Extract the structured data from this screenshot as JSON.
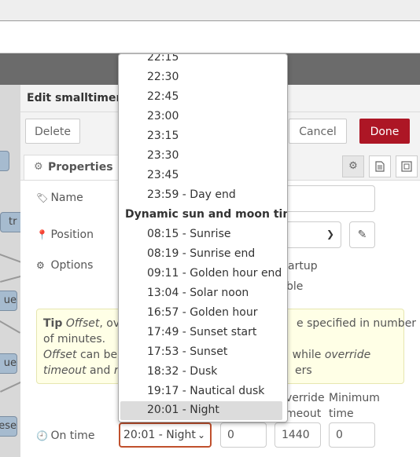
{
  "dialog": {
    "title": "Edit smalltimer node",
    "buttons": {
      "delete": "Delete",
      "cancel": "Cancel",
      "done": "Done"
    },
    "tab": "Properties"
  },
  "workspace": {
    "nodes": [
      "tr",
      "ue",
      "ue",
      "ese"
    ]
  },
  "form": {
    "name_label": "Name",
    "position_label": "Position",
    "options_label": "Options",
    "options_partial": [
      "artup",
      "ble"
    ],
    "on_time_label": "On time"
  },
  "tip": {
    "bold": "Tip",
    "line1_a": "Offset",
    "line1_b": ", over",
    "line1_c": "e specified in number",
    "line2": "of minutes.",
    "line3_a": "Offset",
    "line3_b": " can be b",
    "line3_c": "r, while ",
    "line3_d": "override",
    "line4_a": "timeout",
    "line4_b": " and ",
    "line4_c": "mi",
    "line4_d": "ers"
  },
  "columns": {
    "override_1": "verride",
    "override_2": "meout",
    "minimum_1": "Minimum",
    "minimum_2": "time"
  },
  "on_time": {
    "selected": "20:01 - Night",
    "offset": "0",
    "override_timeout": "1440",
    "minimum_time": "0"
  },
  "dropdown": {
    "times": [
      "22:15",
      "22:30",
      "22:45",
      "23:00",
      "23:15",
      "23:30",
      "23:45",
      "23:59 - Day end"
    ],
    "group_label": "Dynamic sun and moon times",
    "dynamic": [
      "08:15 - Sunrise",
      "08:19 - Sunrise end",
      "09:11 - Golden hour end",
      "13:04 - Solar noon",
      "16:57 - Golden hour",
      "17:49 - Sunset start",
      "17:53 - Sunset",
      "18:32 - Dusk",
      "19:17 - Nautical dusk",
      "20:01 - Night"
    ],
    "selected_index": 9
  },
  "colors": {
    "accent": "#ad1625",
    "node": "#a6bbcf",
    "select_border": "#c0502d",
    "highlight": "#dcdcdc"
  }
}
